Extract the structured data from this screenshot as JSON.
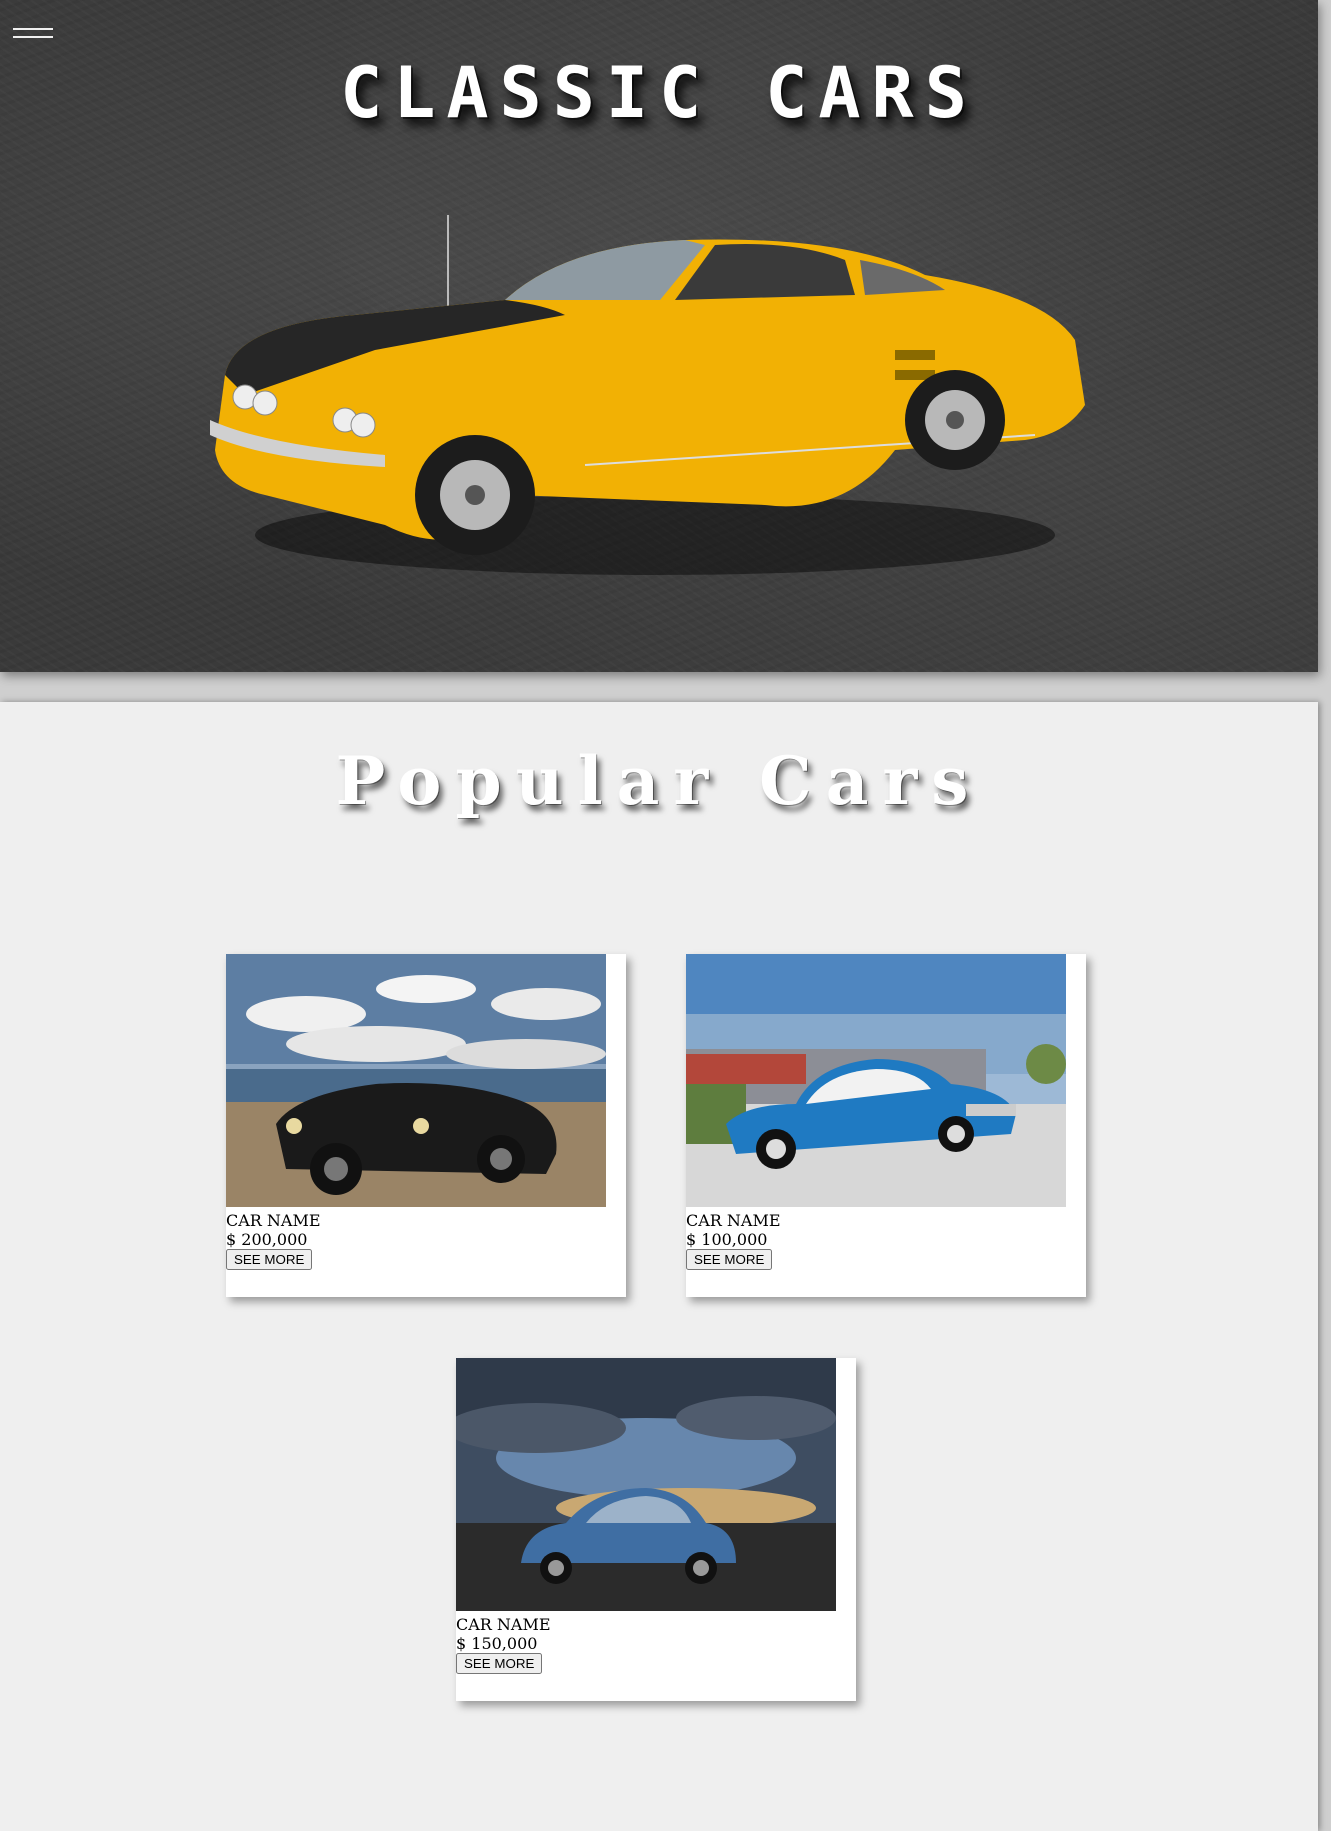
{
  "header": {
    "menu_icon": "hamburger-menu-icon",
    "title": "CLASSIC CARS"
  },
  "section": {
    "title": "Popular Cars"
  },
  "cards": [
    {
      "name": "CAR NAME",
      "price": "$ 200,000",
      "button": "SEE MORE"
    },
    {
      "name": "CAR NAME",
      "price": "$ 100,000",
      "button": "SEE MORE"
    },
    {
      "name": "CAR NAME",
      "price": "$ 150,000",
      "button": "SEE MORE"
    }
  ],
  "colors": {
    "hero_background": "#3a3a3a",
    "hero_car": "#f2b104",
    "page_background": "#efefef"
  }
}
